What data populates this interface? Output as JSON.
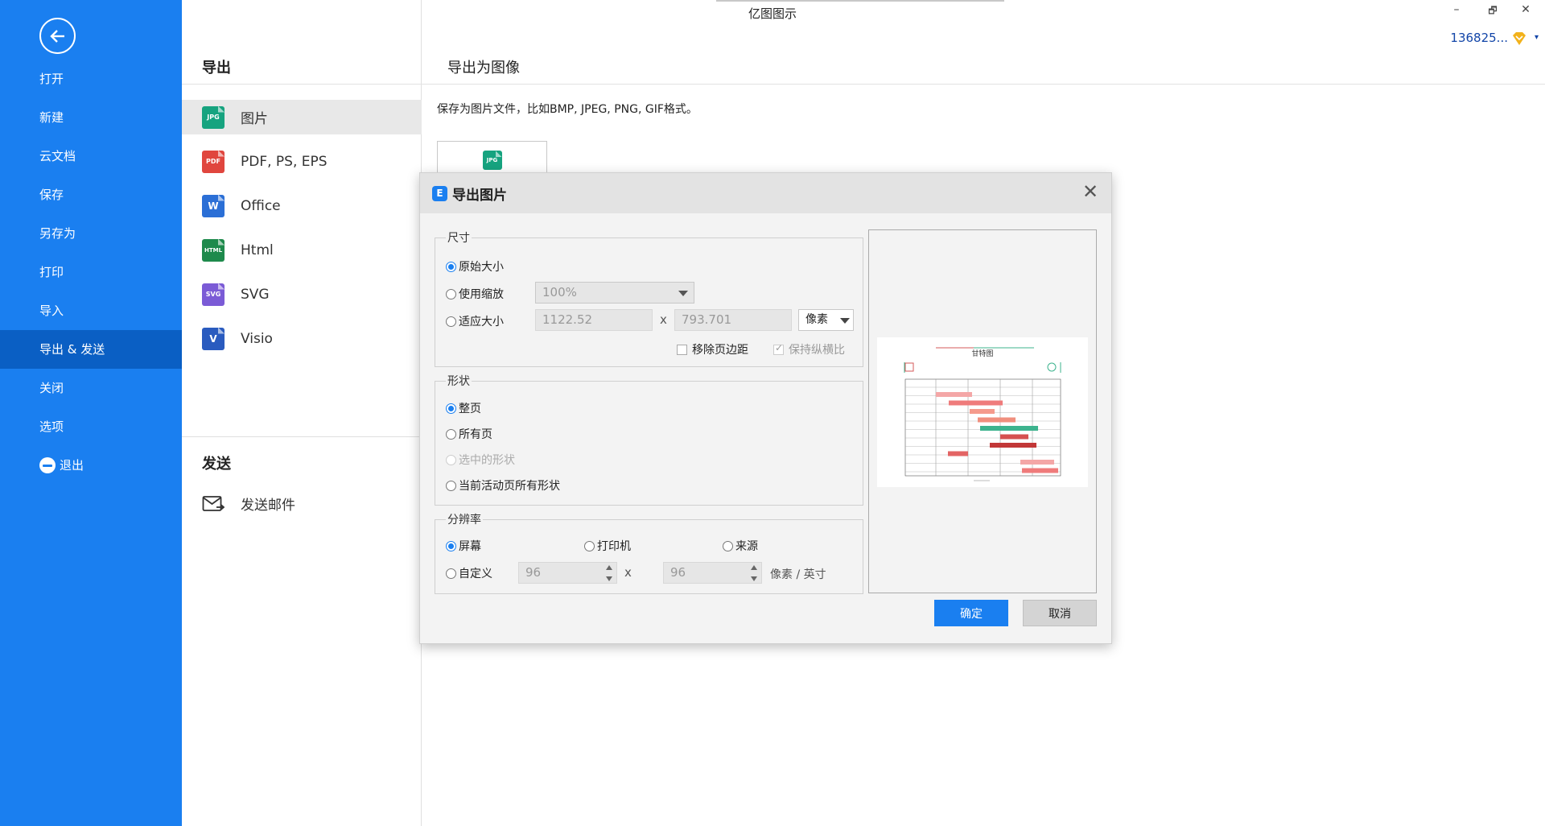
{
  "app": {
    "title": "亿图图示"
  },
  "window_controls": {
    "minimize": "–",
    "restore": "🗗",
    "close": "✕"
  },
  "user": {
    "id": "136825...",
    "vip_caret": "▾"
  },
  "left_nav": {
    "back_icon": "arrow-left-circle-icon",
    "items": [
      {
        "label": "打开"
      },
      {
        "label": "新建"
      },
      {
        "label": "云文档"
      },
      {
        "label": "保存"
      },
      {
        "label": "另存为"
      },
      {
        "label": "打印"
      },
      {
        "label": "导入"
      },
      {
        "label": "导出 & 发送",
        "active": true
      },
      {
        "label": "关闭"
      },
      {
        "label": "选项"
      },
      {
        "label": "退出",
        "icon": "minus-circle-icon"
      }
    ]
  },
  "export_panel": {
    "heading": "导出",
    "items": [
      {
        "label": "图片",
        "icon_text": "JPG",
        "color": "#16a37f",
        "active": true
      },
      {
        "label": "PDF, PS, EPS",
        "icon_text": "PDF",
        "color": "#e0463e"
      },
      {
        "label": "Office",
        "icon_text": "W",
        "color": "#2b6fd6"
      },
      {
        "label": "Html",
        "icon_text": "HTML",
        "color": "#1e8a4c"
      },
      {
        "label": "SVG",
        "icon_text": "SVG",
        "color": "#7b5bd6"
      },
      {
        "label": "Visio",
        "icon_text": "V",
        "color": "#2a5bbf"
      }
    ],
    "send_heading": "发送",
    "send_email": "发送邮件"
  },
  "content": {
    "title": "导出为图像",
    "description": "保存为图片文件，比如BMP, JPEG, PNG, GIF格式。",
    "card_icon_text": "JPG"
  },
  "dialog": {
    "title": "导出图片",
    "logo_text": "E",
    "close": "✕",
    "size_group": {
      "legend": "尺寸",
      "original_size": "原始大小",
      "use_zoom": "使用缩放",
      "zoom_value": "100%",
      "fit_size": "适应大小",
      "width": "1122.52",
      "height": "793.701",
      "x_sep": "x",
      "unit": "像素",
      "remove_margin": "移除页边距",
      "keep_ratio": "保持纵横比"
    },
    "shape_group": {
      "legend": "形状",
      "whole_page": "整页",
      "all_pages": "所有页",
      "selected_shapes": "选中的形状",
      "current_page_shapes": "当前活动页所有形状"
    },
    "resolution_group": {
      "legend": "分辨率",
      "screen": "屏幕",
      "printer": "打印机",
      "source": "来源",
      "custom": "自定义",
      "dpi_x": "96",
      "dpi_y": "96",
      "x_sep": "x",
      "unit": "像素 / 英寸"
    },
    "preview": {
      "doc_title": "甘特图",
      "bar_colors": [
        "#f4a7a7",
        "#ef7b7b",
        "#f59a8c",
        "#f08f7e",
        "#3db38e",
        "#d65050",
        "#c23838",
        "#e36464"
      ]
    },
    "ok": "确定",
    "cancel": "取消"
  },
  "colors": {
    "accent": "#1a7ff0",
    "nav_active": "#0a5fc4",
    "vip": "#f2b21b"
  }
}
